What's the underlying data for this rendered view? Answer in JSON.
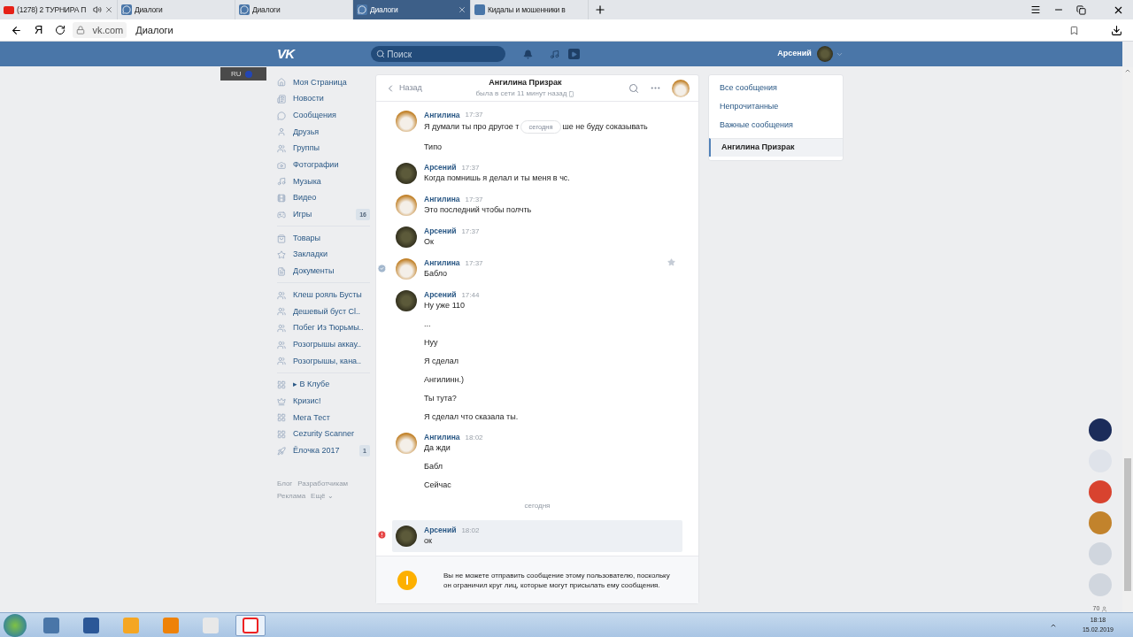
{
  "browser": {
    "tabs": [
      {
        "kind": "youtube",
        "title": "(1278) 2 ТУРНИРА П",
        "audio": true,
        "close": true,
        "selected": false
      },
      {
        "kind": "messages",
        "title": "Диалоги",
        "audio": false,
        "close": false,
        "selected": false
      },
      {
        "kind": "messages",
        "title": "Диалоги",
        "audio": false,
        "close": false,
        "selected": false
      },
      {
        "kind": "messages",
        "title": "Диалоги",
        "audio": false,
        "close": true,
        "selected": true
      },
      {
        "kind": "vk",
        "title": "Кидалы и мошенники в",
        "audio": false,
        "close": false,
        "selected": false
      }
    ],
    "yandex_button": "Я",
    "domain": "vk.com",
    "page_title": "Диалоги"
  },
  "header": {
    "logo": "VK",
    "search": {
      "placeholder": "Поиск"
    },
    "user": "Арсений"
  },
  "language_bar": {
    "language": "RU"
  },
  "sidebar": {
    "sections": [
      [
        {
          "kind": "home",
          "label": "Моя Страница"
        },
        {
          "kind": "news",
          "label": "Новости"
        },
        {
          "kind": "messages",
          "label": "Сообщения"
        },
        {
          "kind": "friends",
          "label": "Друзья"
        },
        {
          "kind": "groups",
          "label": "Группы"
        },
        {
          "kind": "photos",
          "label": "Фотографии"
        },
        {
          "kind": "music",
          "label": "Музыка"
        },
        {
          "kind": "video",
          "label": "Видео"
        },
        {
          "kind": "games",
          "label": "Игры",
          "count": "16"
        }
      ],
      [
        {
          "kind": "goods",
          "label": "Товары"
        },
        {
          "kind": "bookmarks",
          "label": "Закладки"
        },
        {
          "kind": "docs",
          "label": "Документы"
        }
      ],
      [
        {
          "kind": "groups",
          "label": "Клеш рояль Бусты"
        },
        {
          "kind": "groups",
          "label": "Дешевый буст Cl.."
        },
        {
          "kind": "groups",
          "label": "Побег Из Тюрьмы.."
        },
        {
          "kind": "groups",
          "label": "Розогрышы аккау.."
        },
        {
          "kind": "groups",
          "label": "Розогрышы, кана.."
        }
      ],
      [
        {
          "kind": "app",
          "label": "▸ В Клубе"
        },
        {
          "kind": "crisis",
          "label": "Кризис!"
        },
        {
          "kind": "app",
          "label": "Мега Тест"
        },
        {
          "kind": "app",
          "label": "Cezurity Scanner"
        },
        {
          "kind": "rocket",
          "label": "Ёлочка 2017",
          "count": "1"
        }
      ]
    ],
    "footer_links": [
      [
        "Блог",
        "Разработчикам"
      ],
      [
        "Реклама",
        "Ещё ⌄"
      ]
    ]
  },
  "chat": {
    "back": "Назад",
    "title": "Ангилина Призрак",
    "status": "была в сети 11 минут назад",
    "messages": [
      {
        "kind": "peer",
        "author": "Ангилина",
        "time": "17:37",
        "selected": false,
        "failed": false,
        "lines": [
          {
            "parts": [
              "Я думали ты про другое т",
              "ше не буду соказывать"
            ],
            "divider": "сегодня"
          },
          {
            "text": "Типо"
          }
        ]
      },
      {
        "kind": "self",
        "author": "Арсений",
        "time": "17:37",
        "selected": false,
        "failed": false,
        "lines": [
          {
            "text": "Когда помнишь я делал и ты меня в чс."
          }
        ]
      },
      {
        "kind": "peer",
        "author": "Ангилина",
        "time": "17:37",
        "selected": false,
        "failed": false,
        "lines": [
          {
            "text": "Это последний чтобы полчть"
          }
        ]
      },
      {
        "kind": "self",
        "author": "Арсений",
        "time": "17:37",
        "selected": false,
        "failed": false,
        "lines": [
          {
            "text": "Ок"
          }
        ]
      },
      {
        "kind": "peer",
        "author": "Ангилина",
        "time": "17:37",
        "selected": true,
        "failed": false,
        "lines": [
          {
            "text": "Бабло"
          }
        ]
      },
      {
        "kind": "self",
        "author": "Арсений",
        "time": "17:44",
        "selected": false,
        "failed": false,
        "lines": [
          {
            "text": "Ну уже 110"
          },
          {
            "text": "..."
          },
          {
            "text": "Нуу"
          },
          {
            "text": "Я сделал"
          },
          {
            "text": "Ангилинн.)"
          },
          {
            "text": "Ты тута?"
          },
          {
            "text": "Я сделал что сказала ты."
          }
        ]
      },
      {
        "kind": "peer",
        "author": "Ангилина",
        "time": "18:02",
        "selected": false,
        "failed": false,
        "lines": [
          {
            "text": "Да жди"
          },
          {
            "text": "Бабл"
          },
          {
            "text": "Сейчас"
          }
        ]
      },
      {
        "kind": "date",
        "label": "сегодня"
      },
      {
        "kind": "self",
        "author": "Арсений",
        "time": "18:02",
        "selected": false,
        "failed": true,
        "lines": [
          {
            "text": "ок"
          }
        ]
      }
    ],
    "notice": "Вы не можете отправить сообщение этому пользователю, поскольку он ограничил круг лиц, которые могут присылать ему сообщения."
  },
  "filters": [
    {
      "kind": "filter",
      "label": "Все сообщения",
      "selected": false
    },
    {
      "kind": "filter",
      "label": "Непрочитанные",
      "selected": false
    },
    {
      "kind": "filter",
      "label": "Важные сообщения",
      "selected": false
    },
    {
      "kind": "conversation",
      "label": "Ангилина Призрак",
      "selected": true
    }
  ],
  "side_apps": {
    "apps": [
      {
        "color": "#1b2c5a"
      },
      {
        "color": "#dfe3ea"
      },
      {
        "color": "#d8432f"
      },
      {
        "color": "#c2832c"
      },
      {
        "color": "#d0d6de"
      },
      {
        "color": "#d0d6de"
      }
    ],
    "online": "70"
  },
  "taskbar": {
    "apps": [
      {
        "kind": "vk",
        "active": false
      },
      {
        "kind": "word",
        "active": false
      },
      {
        "kind": "player",
        "active": false
      },
      {
        "kind": "ok",
        "active": false
      },
      {
        "kind": "yandex",
        "active": false
      },
      {
        "kind": "ybrowser",
        "active": true
      }
    ],
    "time": "18:18",
    "date": "15.02.2019"
  }
}
